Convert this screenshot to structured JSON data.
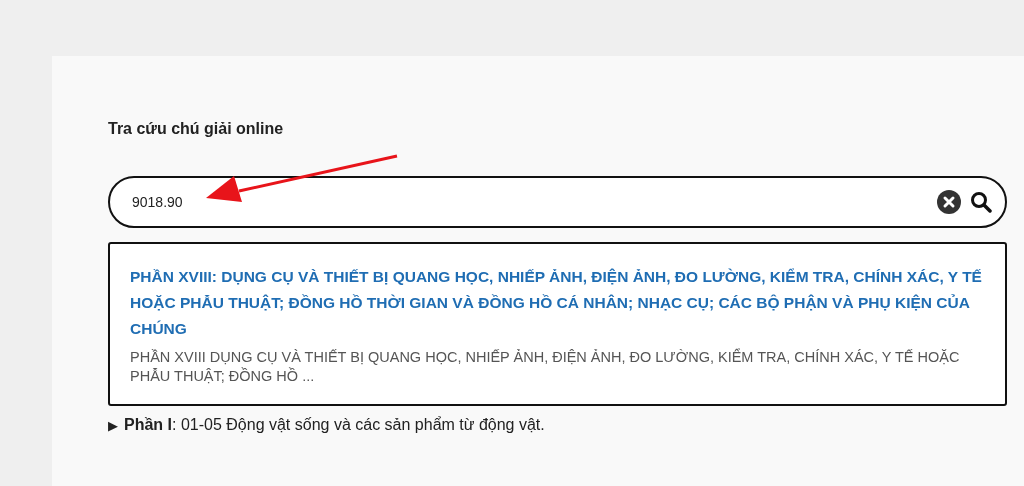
{
  "heading": "Tra cứu chú giải online",
  "search": {
    "value": "9018.90"
  },
  "results": [
    {
      "title": "PHẦN XVIII: DỤNG CỤ VÀ THIẾT BỊ QUANG HỌC, NHIẾP ẢNH, ĐIỆN ẢNH, ĐO LƯỜNG, KIỂM TRA, CHÍNH XÁC, Y TẾ HOẶC PHẪU THUẬT; ĐỒNG HỒ THỜI GIAN VÀ ĐỒNG HỒ CÁ NHÂN; NHẠC CỤ; CÁC BỘ PHẬN VÀ PHỤ KIỆN CỦA CHÚNG",
      "snippet": "PHẦN XVIII DỤNG CỤ VÀ THIẾT BỊ QUANG HỌC, NHIẾP ẢNH, ĐIỆN ẢNH, ĐO LƯỜNG, KIỂM TRA, CHÍNH XÁC, Y TẾ HOẶC PHẪU THUẬT; ĐỒNG HỒ ..."
    }
  ],
  "sections": [
    {
      "marker": "▶",
      "text": "**Phần I**: 01-05 Động vật sống và các sản phẩm từ động vật.",
      "expanded": false
    }
  ]
}
